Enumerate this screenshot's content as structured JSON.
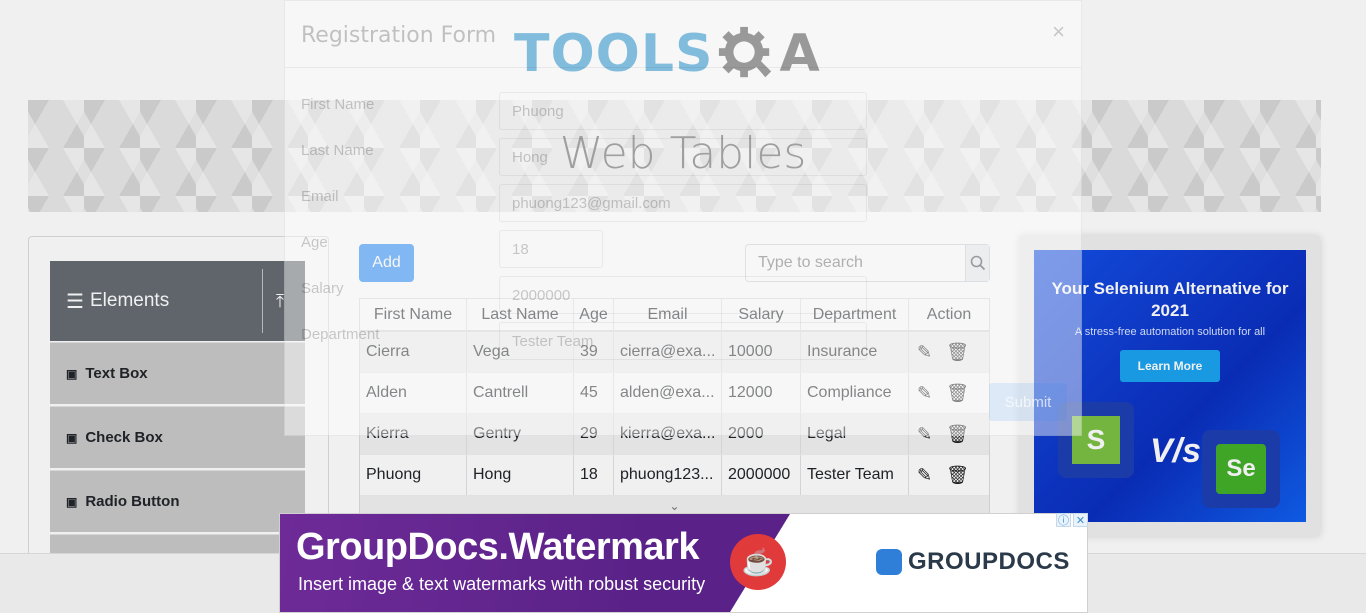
{
  "header": {
    "logo_tools": "TOOLS",
    "logo_qa": "A"
  },
  "banner": {
    "title": "Web Tables"
  },
  "sidebar": {
    "group_label": "Elements",
    "items": [
      {
        "label": "Text Box"
      },
      {
        "label": "Check Box"
      },
      {
        "label": "Radio Button"
      }
    ]
  },
  "toolbar": {
    "add_label": "Add",
    "search_placeholder": "Type to search"
  },
  "table": {
    "columns": [
      "First Name",
      "Last Name",
      "Age",
      "Email",
      "Salary",
      "Department",
      "Action"
    ],
    "rows": [
      [
        "Cierra",
        "Vega",
        "39",
        "cierra@exa...",
        "10000",
        "Insurance"
      ],
      [
        "Alden",
        "Cantrell",
        "45",
        "alden@exa...",
        "12000",
        "Compliance"
      ],
      [
        "Kierra",
        "Gentry",
        "29",
        "kierra@exa...",
        "2000",
        "Legal"
      ],
      [
        "Phuong",
        "Hong",
        "18",
        "phuong123...",
        "2000000",
        "Tester Team"
      ]
    ]
  },
  "modal": {
    "title": "Registration Form",
    "close": "×",
    "labels": [
      "First Name",
      "Last Name",
      "Email",
      "Age",
      "Salary",
      "Department"
    ],
    "values": [
      "Phuong",
      "Hong",
      "phuong123@gmail.com",
      "18",
      "2000000",
      "Tester Team"
    ],
    "submit": "Submit"
  },
  "side_ad": {
    "headline": "Your Selenium Alternative for 2021",
    "subline": "A stress-free automation solution for all",
    "cta": "Learn More",
    "vs": "V/s",
    "left_logo": "S",
    "right_logo": "Se"
  },
  "bottom_ad": {
    "brand": "GroupDocs.Watermark",
    "tagline": "Insert image & text watermarks with robust security",
    "company": "GROUPDOCS"
  },
  "colors": {
    "accent": "#1d85f7",
    "group_header": "#656c71",
    "logo_blue": "#1d8fce",
    "ad_purple": "#6e2b98"
  }
}
